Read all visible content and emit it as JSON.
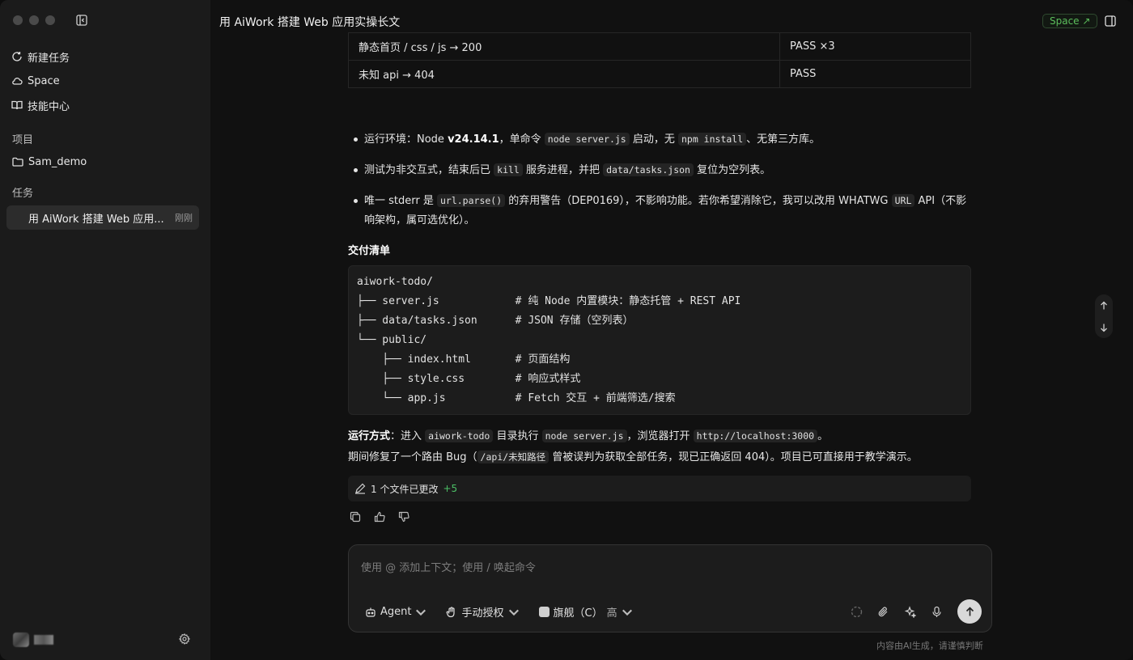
{
  "header": {
    "title": "用 AiWork 搭建 Web 应用实操长文",
    "space_badge": "Space ↗"
  },
  "sidebar": {
    "nav": [
      {
        "label": "新建任务",
        "icon": "refresh-plus-icon"
      },
      {
        "label": "Space",
        "icon": "cloud-icon"
      },
      {
        "label": "技能中心",
        "icon": "book-icon"
      }
    ],
    "projects_label": "项目",
    "project": "Sam_demo",
    "tasks_label": "任务",
    "task": {
      "title": "用 AiWork 搭建 Web 应用...",
      "time": "刚刚"
    }
  },
  "table": {
    "rows": [
      {
        "case": "静态首页 / css / js → 200",
        "result": "PASS ×3"
      },
      {
        "case": "未知 api → 404",
        "result": "PASS"
      }
    ]
  },
  "bullets": {
    "b1": {
      "t1": "运行环境：Node ",
      "ver": "v24.14.1",
      "t2": "，单命令 ",
      "c1": "node server.js",
      "t3": " 启动，无 ",
      "c2": "npm install",
      "t4": "、无第三方库。"
    },
    "b2": {
      "t1": "测试为非交互式，结束后已 ",
      "c1": "kill",
      "t2": " 服务进程，并把 ",
      "c2": "data/tasks.json",
      "t3": " 复位为空列表。"
    },
    "b3": {
      "t1": "唯一 stderr 是 ",
      "c1": "url.parse()",
      "t2": " 的弃用警告（DEP0169），不影响功能。若你希望消除它，我可以改用 WHATWG ",
      "c2": "URL",
      "t3": " API（不影响架构，属可选优化）。"
    }
  },
  "deliver": {
    "heading": "交付清单",
    "tree": "aiwork-todo/\n├── server.js            # 纯 Node 内置模块：静态托管 + REST API\n├── data/tasks.json      # JSON 存储（空列表）\n└── public/\n    ├── index.html       # 页面结构\n    ├── style.css        # 响应式样式\n    └── app.js           # Fetch 交互 + 前端筛选/搜索"
  },
  "run": {
    "label": "运行方式",
    "t1": "：进入 ",
    "c1": "aiwork-todo",
    "t2": " 目录执行 ",
    "c2": "node server.js",
    "t3": "，浏览器打开 ",
    "c3": "http://localhost:3000",
    "t4": "。"
  },
  "fix": {
    "t1": "期间修复了一个路由 Bug（",
    "c1": "/api/未知路径",
    "t2": " 曾被误判为获取全部任务，现已正确返回 404）。项目已可直接用于教学演示。"
  },
  "changed": {
    "label": "1 个文件已更改",
    "count": "+5"
  },
  "composer": {
    "placeholder": "使用 @ 添加上下文；使用 / 唤起命令",
    "agent": "Agent",
    "auth": "手动授权",
    "model": "旗舰（C）",
    "level": "高"
  },
  "disclaimer": "内容由AI生成，请谨慎判断",
  "colors": {
    "accent_green": "#5cbf5c",
    "plus_green": "#4cc066",
    "background": "#111111"
  }
}
